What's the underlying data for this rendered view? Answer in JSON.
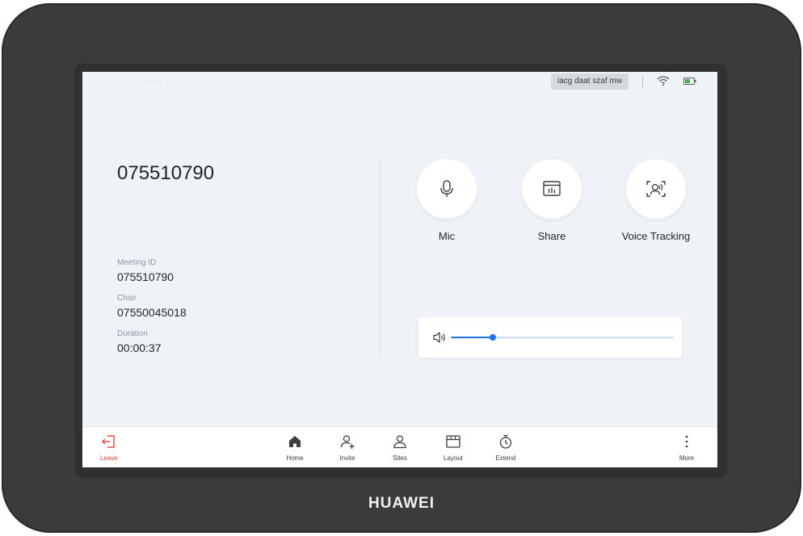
{
  "brand": "HUAWEI",
  "status_bar": {
    "system_name": "HUAWEI Board",
    "chip_text": "iacg daat szaf mw"
  },
  "meeting": {
    "title": "075510790",
    "fields": [
      {
        "label": "Meeting ID",
        "value": "075510790"
      },
      {
        "label": "Chair",
        "value": "07550045018"
      },
      {
        "label": "Duration",
        "value": "00:00:37"
      }
    ]
  },
  "controls": [
    {
      "label": "Mic",
      "icon": "mic-icon"
    },
    {
      "label": "Share",
      "icon": "share-icon"
    },
    {
      "label": "Voice Tracking",
      "icon": "voice-tracking-icon"
    }
  ],
  "volume": {
    "icon": "speaker-icon",
    "level_percent": 19
  },
  "toolbar": {
    "leave": "Leave",
    "home": "Home",
    "invite": "Invite",
    "sites": "Sites",
    "layout": "Layout",
    "extend": "Extend",
    "more": "More"
  },
  "colors": {
    "accent": "#1a73e8",
    "leave": "#e8453c",
    "screen_bg": "#eff3f8",
    "device": "#3a3b3c"
  }
}
